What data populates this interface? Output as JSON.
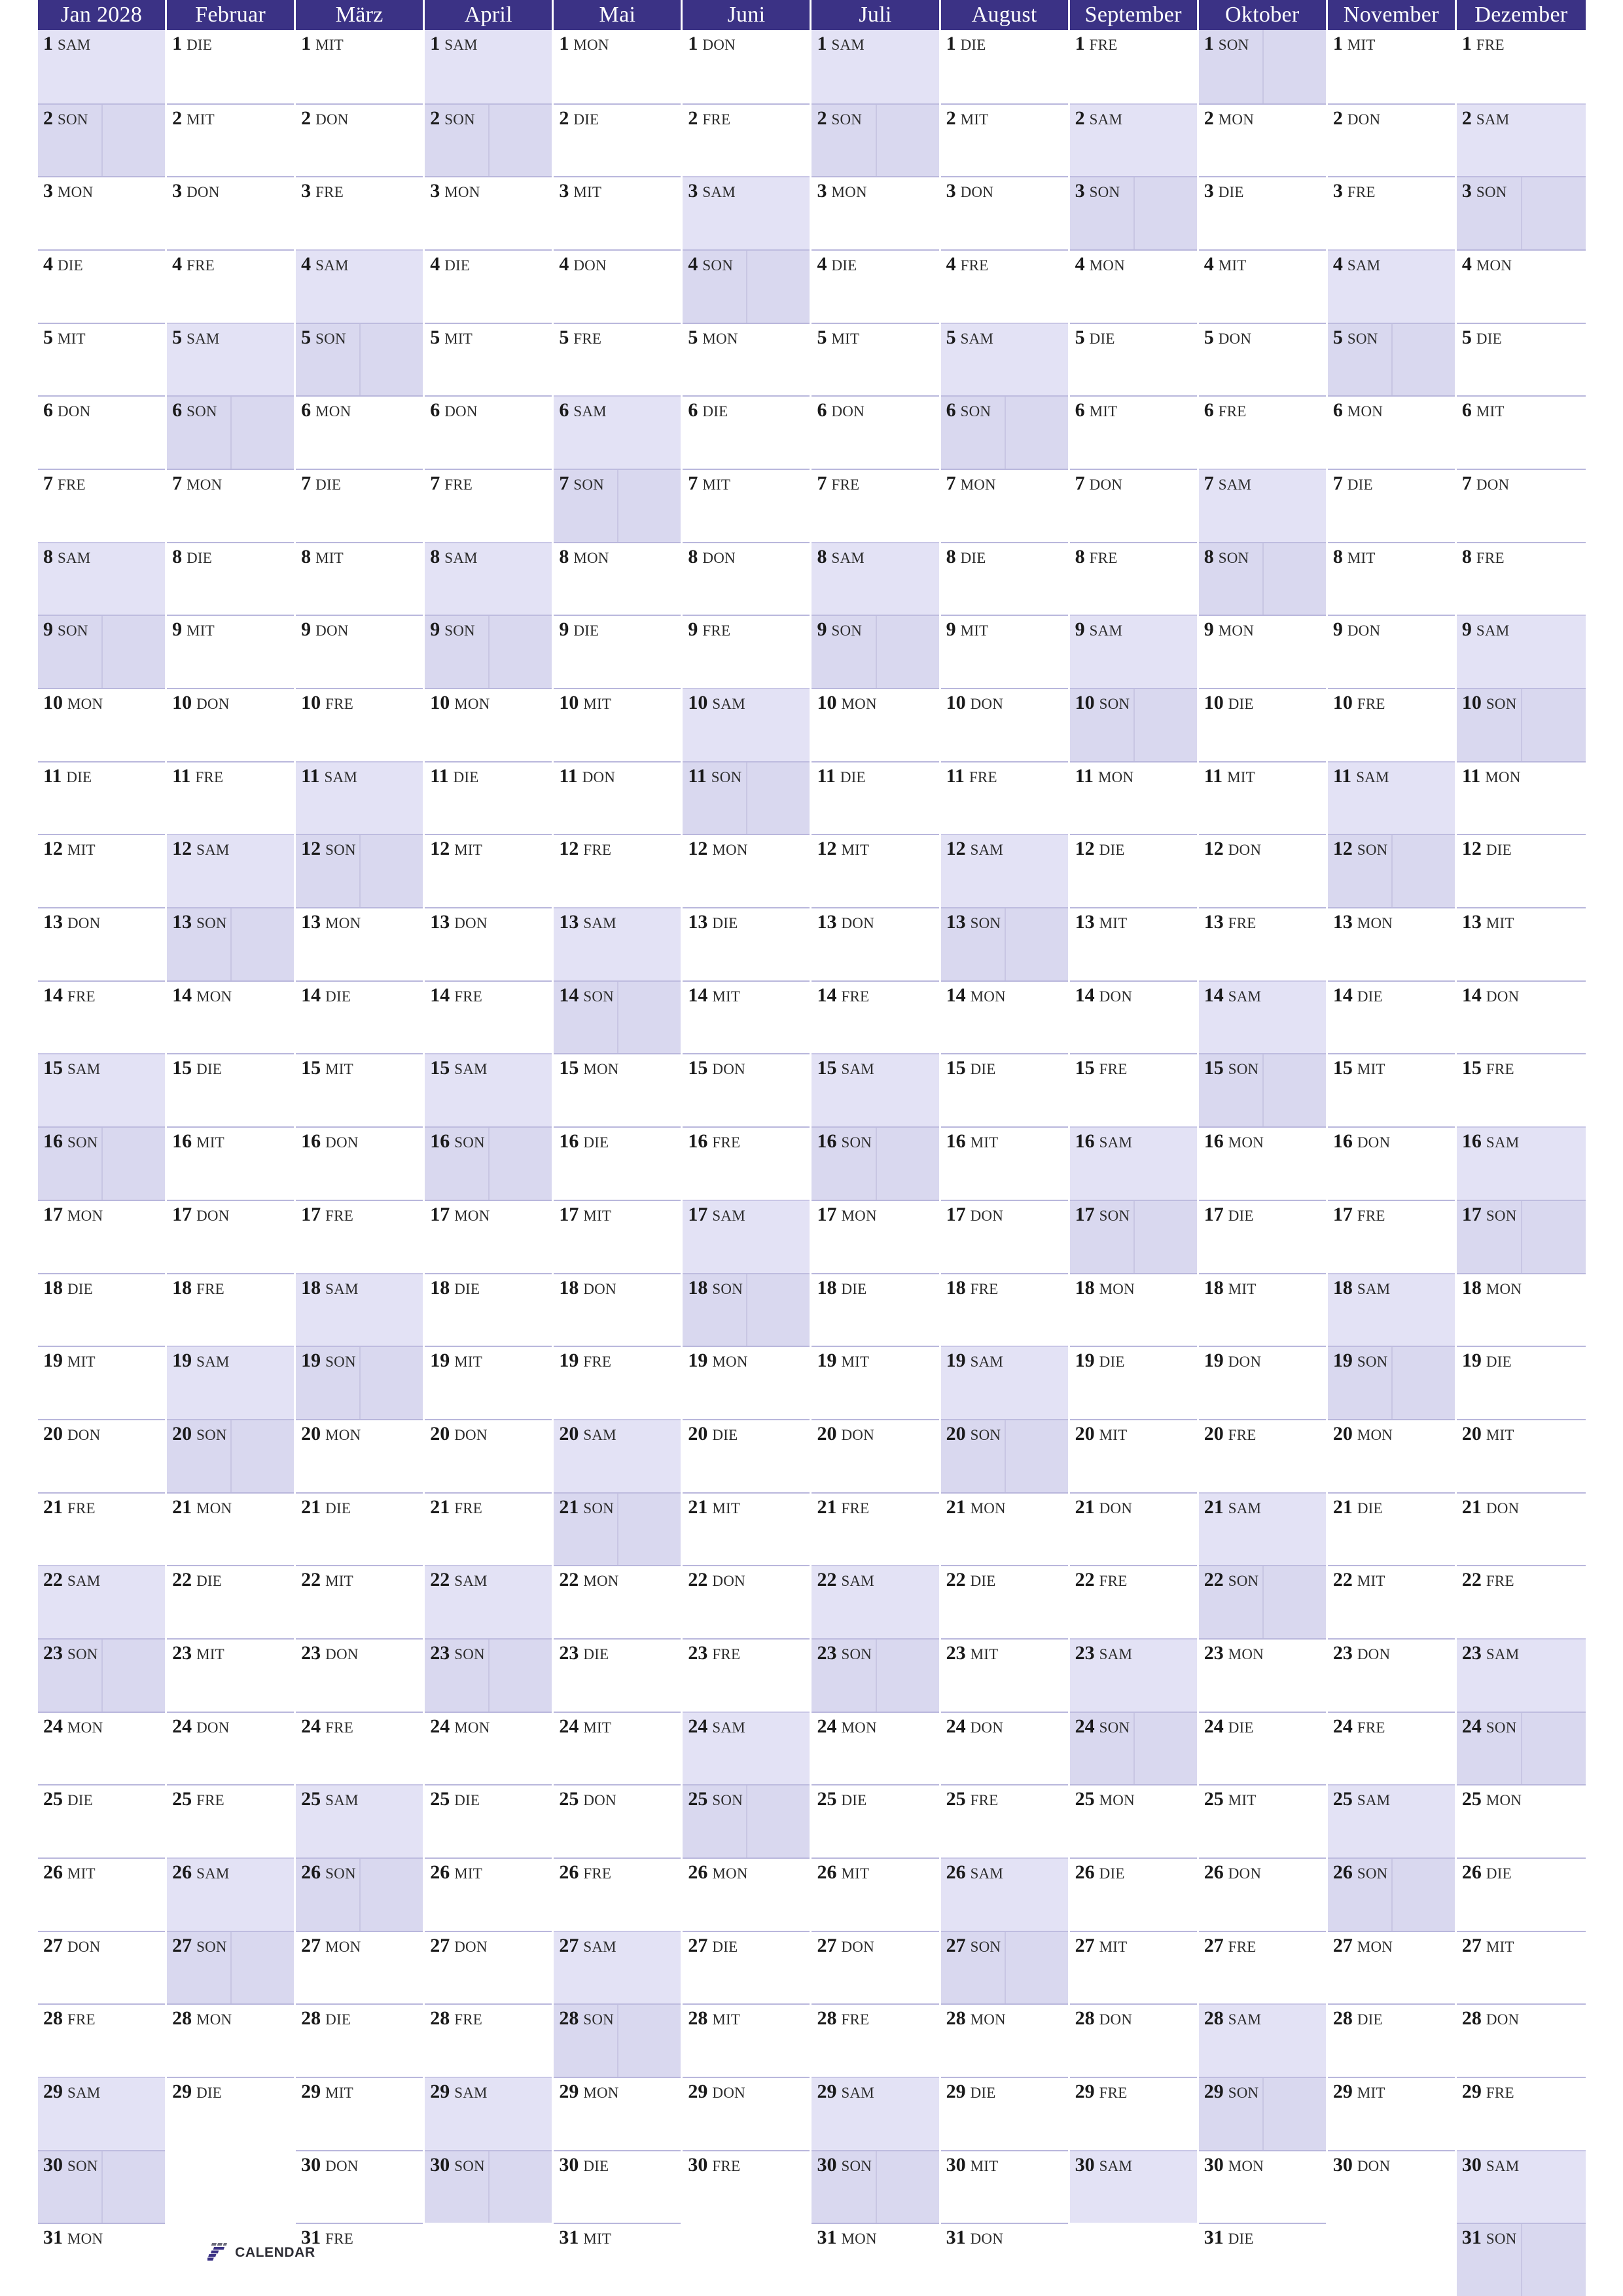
{
  "planner": {
    "year": "2028",
    "locale": "de",
    "title": "Jan 2028",
    "weekday_names": [
      "MON",
      "DIE",
      "MIT",
      "DON",
      "FRE",
      "SAM",
      "SON"
    ],
    "colors": {
      "header_bg": "#3b3285",
      "header_text": "#ffffff",
      "saturday_bg": "#e3e2f5",
      "sunday_bg": "#d9d8ef",
      "rule": "#b9b7dc",
      "day_text": "#1a1a1a",
      "brand_purple": "#3b3285",
      "brand_gray": "#6d6d7c",
      "brand_text": "#2c2c34"
    },
    "months": [
      {
        "name": "Jan 2028",
        "short": "Januar",
        "index": 1,
        "days": 31,
        "weekdays": [
          "SAM",
          "SON",
          "MON",
          "DIE",
          "MIT",
          "DON",
          "FRE",
          "SAM",
          "SON",
          "MON",
          "DIE",
          "MIT",
          "DON",
          "FRE",
          "SAM",
          "SON",
          "MON",
          "DIE",
          "MIT",
          "DON",
          "FRE",
          "SAM",
          "SON",
          "MON",
          "DIE",
          "MIT",
          "DON",
          "FRE",
          "SAM",
          "SON",
          "MON"
        ]
      },
      {
        "name": "Februar",
        "short": "Februar",
        "index": 2,
        "days": 29,
        "weekdays": [
          "DIE",
          "MIT",
          "DON",
          "FRE",
          "SAM",
          "SON",
          "MON",
          "DIE",
          "MIT",
          "DON",
          "FRE",
          "SAM",
          "SON",
          "MON",
          "DIE",
          "MIT",
          "DON",
          "FRE",
          "SAM",
          "SON",
          "MON",
          "DIE",
          "MIT",
          "DON",
          "FRE",
          "SAM",
          "SON",
          "MON",
          "DIE"
        ]
      },
      {
        "name": "März",
        "short": "März",
        "index": 3,
        "days": 31,
        "weekdays": [
          "MIT",
          "DON",
          "FRE",
          "SAM",
          "SON",
          "MON",
          "DIE",
          "MIT",
          "DON",
          "FRE",
          "SAM",
          "SON",
          "MON",
          "DIE",
          "MIT",
          "DON",
          "FRE",
          "SAM",
          "SON",
          "MON",
          "DIE",
          "MIT",
          "DON",
          "FRE",
          "SAM",
          "SON",
          "MON",
          "DIE",
          "MIT",
          "DON",
          "FRE"
        ]
      },
      {
        "name": "April",
        "short": "April",
        "index": 4,
        "days": 30,
        "weekdays": [
          "SAM",
          "SON",
          "MON",
          "DIE",
          "MIT",
          "DON",
          "FRE",
          "SAM",
          "SON",
          "MON",
          "DIE",
          "MIT",
          "DON",
          "FRE",
          "SAM",
          "SON",
          "MON",
          "DIE",
          "MIT",
          "DON",
          "FRE",
          "SAM",
          "SON",
          "MON",
          "DIE",
          "MIT",
          "DON",
          "FRE",
          "SAM",
          "SON"
        ]
      },
      {
        "name": "Mai",
        "short": "Mai",
        "index": 5,
        "days": 31,
        "weekdays": [
          "MON",
          "DIE",
          "MIT",
          "DON",
          "FRE",
          "SAM",
          "SON",
          "MON",
          "DIE",
          "MIT",
          "DON",
          "FRE",
          "SAM",
          "SON",
          "MON",
          "DIE",
          "MIT",
          "DON",
          "FRE",
          "SAM",
          "SON",
          "MON",
          "DIE",
          "MIT",
          "DON",
          "FRE",
          "SAM",
          "SON",
          "MON",
          "DIE",
          "MIT"
        ]
      },
      {
        "name": "Juni",
        "short": "Juni",
        "index": 6,
        "days": 30,
        "weekdays": [
          "DON",
          "FRE",
          "SAM",
          "SON",
          "MON",
          "DIE",
          "MIT",
          "DON",
          "FRE",
          "SAM",
          "SON",
          "MON",
          "DIE",
          "MIT",
          "DON",
          "FRE",
          "SAM",
          "SON",
          "MON",
          "DIE",
          "MIT",
          "DON",
          "FRE",
          "SAM",
          "SON",
          "MON",
          "DIE",
          "MIT",
          "DON",
          "FRE"
        ]
      },
      {
        "name": "Juli",
        "short": "Juli",
        "index": 7,
        "days": 31,
        "weekdays": [
          "SAM",
          "SON",
          "MON",
          "DIE",
          "MIT",
          "DON",
          "FRE",
          "SAM",
          "SON",
          "MON",
          "DIE",
          "MIT",
          "DON",
          "FRE",
          "SAM",
          "SON",
          "MON",
          "DIE",
          "MIT",
          "DON",
          "FRE",
          "SAM",
          "SON",
          "MON",
          "DIE",
          "MIT",
          "DON",
          "FRE",
          "SAM",
          "SON",
          "MON"
        ]
      },
      {
        "name": "August",
        "short": "August",
        "index": 8,
        "days": 31,
        "weekdays": [
          "DIE",
          "MIT",
          "DON",
          "FRE",
          "SAM",
          "SON",
          "MON",
          "DIE",
          "MIT",
          "DON",
          "FRE",
          "SAM",
          "SON",
          "MON",
          "DIE",
          "MIT",
          "DON",
          "FRE",
          "SAM",
          "SON",
          "MON",
          "DIE",
          "MIT",
          "DON",
          "FRE",
          "SAM",
          "SON",
          "MON",
          "DIE",
          "MIT",
          "DON"
        ]
      },
      {
        "name": "September",
        "short": "September",
        "index": 9,
        "days": 30,
        "weekdays": [
          "FRE",
          "SAM",
          "SON",
          "MON",
          "DIE",
          "MIT",
          "DON",
          "FRE",
          "SAM",
          "SON",
          "MON",
          "DIE",
          "MIT",
          "DON",
          "FRE",
          "SAM",
          "SON",
          "MON",
          "DIE",
          "MIT",
          "DON",
          "FRE",
          "SAM",
          "SON",
          "MON",
          "DIE",
          "MIT",
          "DON",
          "FRE",
          "SAM"
        ]
      },
      {
        "name": "Oktober",
        "short": "Oktober",
        "index": 10,
        "days": 31,
        "weekdays": [
          "SON",
          "MON",
          "DIE",
          "MIT",
          "DON",
          "FRE",
          "SAM",
          "SON",
          "MON",
          "DIE",
          "MIT",
          "DON",
          "FRE",
          "SAM",
          "SON",
          "MON",
          "DIE",
          "MIT",
          "DON",
          "FRE",
          "SAM",
          "SON",
          "MON",
          "DIE",
          "MIT",
          "DON",
          "FRE",
          "SAM",
          "SON",
          "MON",
          "DIE"
        ]
      },
      {
        "name": "November",
        "short": "November",
        "index": 11,
        "days": 30,
        "weekdays": [
          "MIT",
          "DON",
          "FRE",
          "SAM",
          "SON",
          "MON",
          "DIE",
          "MIT",
          "DON",
          "FRE",
          "SAM",
          "SON",
          "MON",
          "DIE",
          "MIT",
          "DON",
          "FRE",
          "SAM",
          "SON",
          "MON",
          "DIE",
          "MIT",
          "DON",
          "FRE",
          "SAM",
          "SON",
          "MON",
          "DIE",
          "MIT",
          "DON"
        ]
      },
      {
        "name": "Dezember",
        "short": "Dezember",
        "index": 12,
        "days": 31,
        "weekdays": [
          "FRE",
          "SAM",
          "SON",
          "MON",
          "DIE",
          "MIT",
          "DON",
          "FRE",
          "SAM",
          "SON",
          "MON",
          "DIE",
          "MIT",
          "DON",
          "FRE",
          "SAM",
          "SON",
          "MON",
          "DIE",
          "MIT",
          "DON",
          "FRE",
          "SAM",
          "SON",
          "MON",
          "DIE",
          "MIT",
          "DON",
          "FRE",
          "SAM",
          "SON"
        ]
      }
    ]
  },
  "brand": {
    "mark": "seven-logo-icon",
    "text": "CALENDAR"
  }
}
